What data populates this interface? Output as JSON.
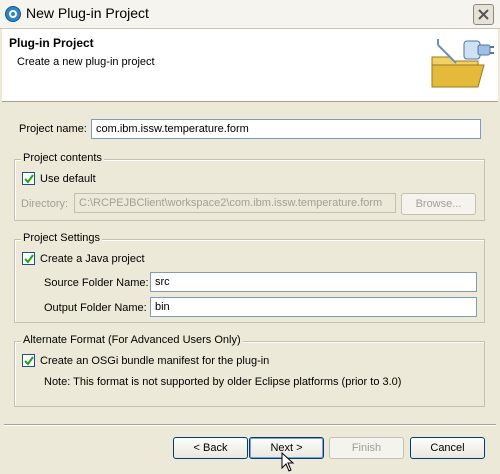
{
  "window": {
    "title": "New Plug-in Project",
    "app_icon": "eclipse-icon",
    "close_icon": "close-icon"
  },
  "header": {
    "title": "Plug-in Project",
    "description": "Create a new plug-in project",
    "graphic_icon": "new-plugin-wizard-graphic"
  },
  "project_name": {
    "label": "Project name:",
    "value": "com.ibm.issw.temperature.form"
  },
  "project_contents": {
    "group_label": "Project contents",
    "use_default_label": "Use default",
    "use_default_checked": true,
    "directory_label": "Directory:",
    "directory_value": "C:\\RCPEJBClient\\workspace2\\com.ibm.issw.temperature.form",
    "browse_label": "Browse..."
  },
  "project_settings": {
    "group_label": "Project Settings",
    "java_project_label": "Create a Java project",
    "java_project_checked": true,
    "source_folder_label": "Source Folder Name:",
    "source_folder_value": "src",
    "output_folder_label": "Output Folder Name:",
    "output_folder_value": "bin"
  },
  "alternate_format": {
    "group_label": "Alternate Format (For Advanced Users Only)",
    "osgi_label": "Create an OSGi bundle manifest for the plug-in",
    "osgi_checked": true,
    "note": "Note: This format is not supported by older Eclipse platforms (prior to 3.0)"
  },
  "buttons": {
    "back": "< Back",
    "next": "Next >",
    "finish": "Finish",
    "cancel": "Cancel"
  },
  "colors": {
    "dialog_background": "#ece9d8",
    "field_border": "#7f9db9",
    "disabled_text": "#a19f94"
  }
}
